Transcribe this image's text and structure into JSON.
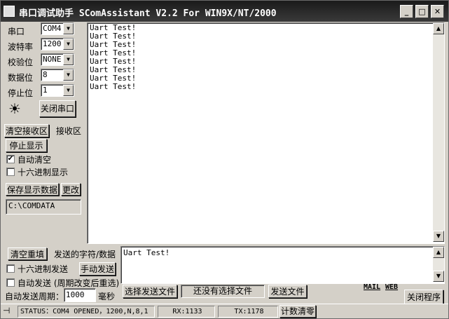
{
  "window": {
    "title": "串口调试助手 SComAssistant V2.2 For WIN9X/NT/2000",
    "min_glyph": "_",
    "max_glyph": "□",
    "close_glyph": "✕"
  },
  "settings": {
    "port_label": "串口",
    "port_value": "COM4",
    "baud_label": "波特率",
    "baud_value": "1200",
    "parity_label": "校验位",
    "parity_value": "NONE",
    "databits_label": "数据位",
    "databits_value": "8",
    "stopbits_label": "停止位",
    "stopbits_value": "1",
    "close_port_label": "关闭串口"
  },
  "receive": {
    "clear_label": "清空接收区",
    "area_label": "接收区",
    "stop_display_label": "停止显示",
    "auto_clear_label": "自动清空",
    "auto_clear_checked": "✔",
    "hex_display_label": "十六进制显示",
    "save_data_label": "保存显示数据",
    "change_label": "更改",
    "save_path": "C:\\COMDATA",
    "lines": [
      "Uart Test!",
      "Uart Test!",
      "Uart Test!",
      "Uart Test!",
      "Uart Test!",
      "Uart Test!",
      "Uart Test!",
      "Uart Test!"
    ]
  },
  "send": {
    "clear_label": "清空重填",
    "area_label": "发送的字符/数据",
    "text": "Uart Test!",
    "hex_send_label": "十六进制发送",
    "manual_send_label": "手动发送",
    "auto_send_label": "自动发送 (周期改变后重选)",
    "period_label": "自动发送周期：",
    "period_value": "1000",
    "period_unit": "毫秒",
    "select_file_label": "选择发送文件",
    "no_file_label": "还没有选择文件",
    "send_file_label": "发送文件",
    "mail_label": "MAIL",
    "web_label": "WEB",
    "exit_label": "关闭程序"
  },
  "status": {
    "status_text": "STATUS：COM4 OPENED，1200,N,8,1",
    "rx_text": "RX:1133",
    "tx_text": "TX:1178",
    "reset_count_label": "计数清零"
  },
  "scroll": {
    "up_glyph": "▲",
    "down_glyph": "▼"
  },
  "icons": {
    "led": "☀",
    "dropdown": "▼"
  }
}
